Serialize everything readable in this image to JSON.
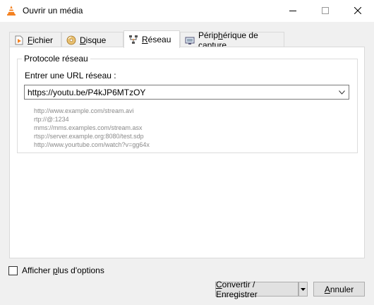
{
  "window": {
    "title": "Ouvrir un média",
    "icon": "vlc-cone-icon",
    "controls": [
      "minimize",
      "maximize",
      "close"
    ]
  },
  "tabs": [
    {
      "label_pre": "",
      "label_accel": "F",
      "label_post": "ichier",
      "icon": "file-icon",
      "active": false
    },
    {
      "label_pre": "",
      "label_accel": "D",
      "label_post": "isque",
      "icon": "disc-icon",
      "active": false
    },
    {
      "label_pre": "",
      "label_accel": "R",
      "label_post": "éseau",
      "icon": "network-icon",
      "active": true
    },
    {
      "label_pre": "Périp",
      "label_accel": "h",
      "label_post": "érique de capture",
      "icon": "capture-device-icon",
      "active": false
    }
  ],
  "network": {
    "group_title": "Protocole réseau",
    "url_label": "Entrer une URL réseau :",
    "url_value": "https://youtu.be/P4kJP6MTzOY",
    "examples": [
      "http://www.example.com/stream.avi",
      "rtp://@:1234",
      "mms://mms.examples.com/stream.asx",
      "rtsp://server.example.org:8080/test.sdp",
      "http://www.yourtube.com/watch?v=gg64x"
    ]
  },
  "options": {
    "more_pre": "Afficher ",
    "more_accel": "p",
    "more_post": "lus d'options",
    "checked": false
  },
  "buttons": {
    "convert_accel": "C",
    "convert_post": "onvertir / Enregistrer",
    "cancel_accel": "A",
    "cancel_post": "nnuler"
  },
  "colors": {
    "accent_vlc": "#f48120",
    "window_bg": "#f0f0f0",
    "panel_bg": "#ffffff",
    "example_text": "#8a8a8a"
  }
}
